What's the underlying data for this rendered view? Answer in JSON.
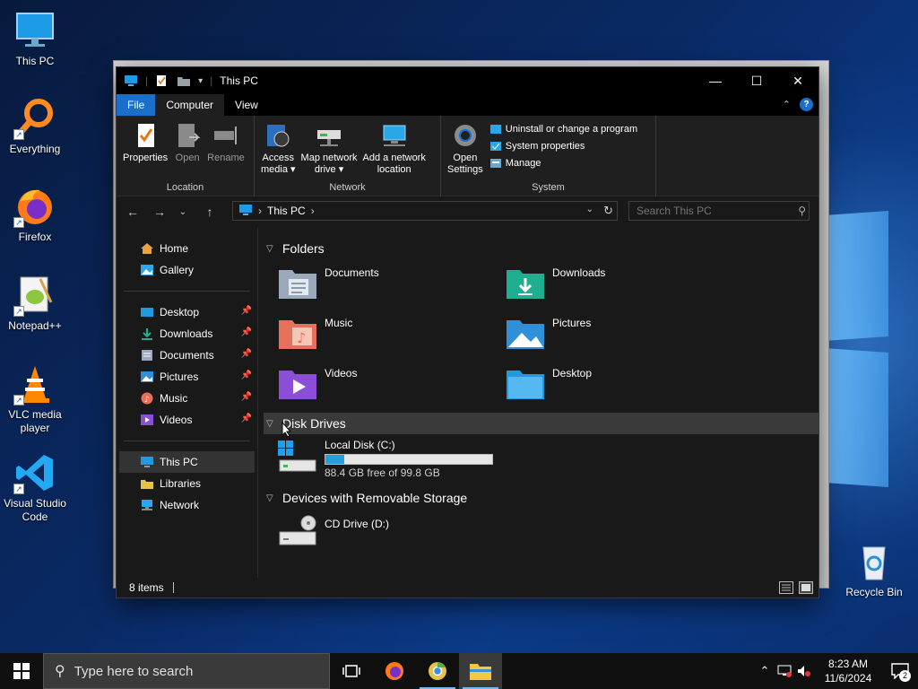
{
  "desktop": {
    "icons": [
      {
        "label": "This PC",
        "icon": "monitor-icon"
      },
      {
        "label": "Everything",
        "icon": "magnifier-icon"
      },
      {
        "label": "Firefox",
        "icon": "firefox-icon"
      },
      {
        "label": "Notepad++",
        "icon": "notepadpp-icon"
      },
      {
        "label": "VLC media player",
        "icon": "vlc-cone-icon"
      },
      {
        "label": "Visual Studio Code",
        "icon": "vscode-icon"
      }
    ],
    "recycle_bin": {
      "label": "Recycle Bin",
      "icon": "recycle-bin-icon"
    }
  },
  "window": {
    "title": "This PC",
    "ribbon_tabs": {
      "file": "File",
      "computer": "Computer",
      "view": "View"
    },
    "ribbon": {
      "location": {
        "group_label": "Location",
        "properties": "Properties",
        "open": "Open",
        "rename": "Rename"
      },
      "network": {
        "group_label": "Network",
        "access_media_1": "Access",
        "access_media_2": "media ▾",
        "map_drive_1": "Map network",
        "map_drive_2": "drive ▾",
        "add_location_1": "Add a network",
        "add_location_2": "location"
      },
      "system": {
        "group_label": "System",
        "open_settings_1": "Open",
        "open_settings_2": "Settings",
        "uninstall": "Uninstall or change a program",
        "system_properties": "System properties",
        "manage": "Manage"
      }
    },
    "address": {
      "breadcrumb": "This PC"
    },
    "search": {
      "placeholder": "Search This PC"
    },
    "nav_pane": {
      "home": "Home",
      "gallery": "Gallery",
      "quick_access": [
        {
          "label": "Desktop",
          "pinned": true
        },
        {
          "label": "Downloads",
          "pinned": true
        },
        {
          "label": "Documents",
          "pinned": true
        },
        {
          "label": "Pictures",
          "pinned": true
        },
        {
          "label": "Music",
          "pinned": true
        },
        {
          "label": "Videos",
          "pinned": true
        }
      ],
      "this_pc": "This PC",
      "libraries": "Libraries",
      "network": "Network"
    },
    "content": {
      "folders_header": "Folders",
      "folders": [
        {
          "label": "Documents",
          "color": "#9aa9bb"
        },
        {
          "label": "Downloads",
          "color": "#1fae8f"
        },
        {
          "label": "Music",
          "color": "#e8705a"
        },
        {
          "label": "Pictures",
          "color": "#2f8fd8"
        },
        {
          "label": "Videos",
          "color": "#8a4fd6"
        },
        {
          "label": "Desktop",
          "color": "#1e9be0"
        }
      ],
      "drives_header": "Disk Drives",
      "local_disk": {
        "label": "Local Disk (C:)",
        "free": "88.4 GB free of 99.8 GB",
        "used_fraction": 0.114
      },
      "removable_header": "Devices with Removable Storage",
      "cd_drive": {
        "label": "CD Drive (D:)"
      }
    },
    "status": {
      "items": "8 items"
    }
  },
  "taskbar": {
    "search_placeholder": "Type here to search",
    "time": "8:23 AM",
    "date": "11/6/2024",
    "notifications": "2"
  },
  "colors": {
    "accent": "#1a6fc9",
    "window_bg": "#191919",
    "ribbon_bg": "#1f1f1f",
    "drive_bar": "#26a0da"
  }
}
